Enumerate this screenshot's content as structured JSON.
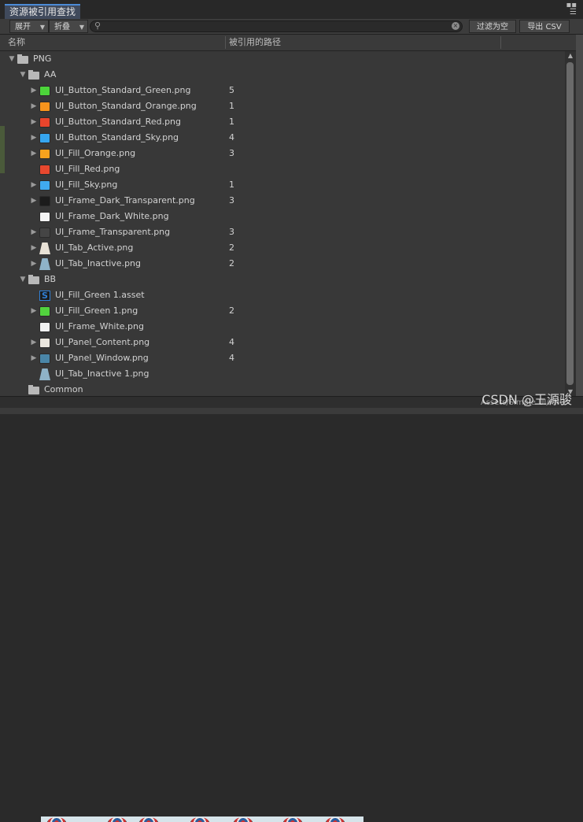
{
  "window": {
    "tab_title": "资源被引用查找"
  },
  "toolbar": {
    "expand_label": "展开",
    "collapse_label": "折叠",
    "search_value": "",
    "filter_empty_label": "过滤为空",
    "export_csv_label": "导出 CSV"
  },
  "header": {
    "name_col": "名称",
    "path_col": "被引用的路径"
  },
  "rows": [
    {
      "label": "PNG",
      "count": "",
      "icon": "folder-icon",
      "arrow": "down",
      "depth": 0,
      "color": ""
    },
    {
      "label": "AA",
      "count": "",
      "icon": "folder-icon",
      "arrow": "down",
      "depth": 1,
      "color": ""
    },
    {
      "label": "UI_Button_Standard_Green.png",
      "count": "5",
      "icon": "image-icon",
      "arrow": "right",
      "depth": 2,
      "color": "#4cd43a"
    },
    {
      "label": "UI_Button_Standard_Orange.png",
      "count": "1",
      "icon": "image-icon",
      "arrow": "right",
      "depth": 2,
      "color": "#f7941d"
    },
    {
      "label": "UI_Button_Standard_Red.png",
      "count": "1",
      "icon": "image-icon",
      "arrow": "right",
      "depth": 2,
      "color": "#e8452c"
    },
    {
      "label": "UI_Button_Standard_Sky.png",
      "count": "4",
      "icon": "image-icon",
      "arrow": "right",
      "depth": 2,
      "color": "#36a6ef"
    },
    {
      "label": "UI_Fill_Orange.png",
      "count": "3",
      "icon": "image-icon",
      "arrow": "right",
      "depth": 2,
      "color": "#f7a21d"
    },
    {
      "label": "UI_Fill_Red.png",
      "count": "",
      "icon": "image-icon",
      "arrow": "none",
      "depth": 2,
      "color": "#e8482e"
    },
    {
      "label": "UI_Fill_Sky.png",
      "count": "1",
      "icon": "image-icon",
      "arrow": "right",
      "depth": 2,
      "color": "#40aaf0"
    },
    {
      "label": "UI_Frame_Dark_Transparent.png",
      "count": "3",
      "icon": "image-icon",
      "arrow": "right",
      "depth": 2,
      "color": "#1c1c1c"
    },
    {
      "label": "UI_Frame_Dark_White.png",
      "count": "",
      "icon": "image-icon",
      "arrow": "none",
      "depth": 2,
      "color": "#f4f4f4"
    },
    {
      "label": "UI_Frame_Transparent.png",
      "count": "3",
      "icon": "image-icon",
      "arrow": "right",
      "depth": 2,
      "color": "#454545"
    },
    {
      "label": "UI_Tab_Active.png",
      "count": "2",
      "icon": "tab-image-icon",
      "arrow": "right",
      "depth": 2,
      "color": "#e9e2d6"
    },
    {
      "label": "UI_Tab_Inactive.png",
      "count": "2",
      "icon": "tab-image-icon",
      "arrow": "right",
      "depth": 2,
      "color": "#8fb3c8"
    },
    {
      "label": "BB",
      "count": "",
      "icon": "folder-icon",
      "arrow": "down",
      "depth": 1,
      "color": ""
    },
    {
      "label": "UI_Fill_Green 1.asset",
      "count": "",
      "icon": "script-asset-icon",
      "arrow": "none",
      "depth": 2,
      "color": "#2f7fd6"
    },
    {
      "label": "UI_Fill_Green 1.png",
      "count": "2",
      "icon": "image-icon",
      "arrow": "right",
      "depth": 2,
      "color": "#52d23e"
    },
    {
      "label": "UI_Frame_White.png",
      "count": "",
      "icon": "image-icon",
      "arrow": "none",
      "depth": 2,
      "color": "#f2f2f2"
    },
    {
      "label": "UI_Panel_Content.png",
      "count": "4",
      "icon": "image-icon",
      "arrow": "right",
      "depth": 2,
      "color": "#eae6de"
    },
    {
      "label": "UI_Panel_Window.png",
      "count": "4",
      "icon": "image-icon",
      "arrow": "right",
      "depth": 2,
      "color": "#4a86a8"
    },
    {
      "label": "UI_Tab_Inactive 1.png",
      "count": "",
      "icon": "tab-image-icon",
      "arrow": "none",
      "depth": 2,
      "color": "#8fb3c8"
    },
    {
      "label": "Common",
      "count": "",
      "icon": "folder-icon",
      "arrow": "none",
      "depth": 1,
      "color": ""
    }
  ],
  "status": {
    "path": "Assets/Simple UI/PNG"
  },
  "watermark": "CSDN @王源骏"
}
